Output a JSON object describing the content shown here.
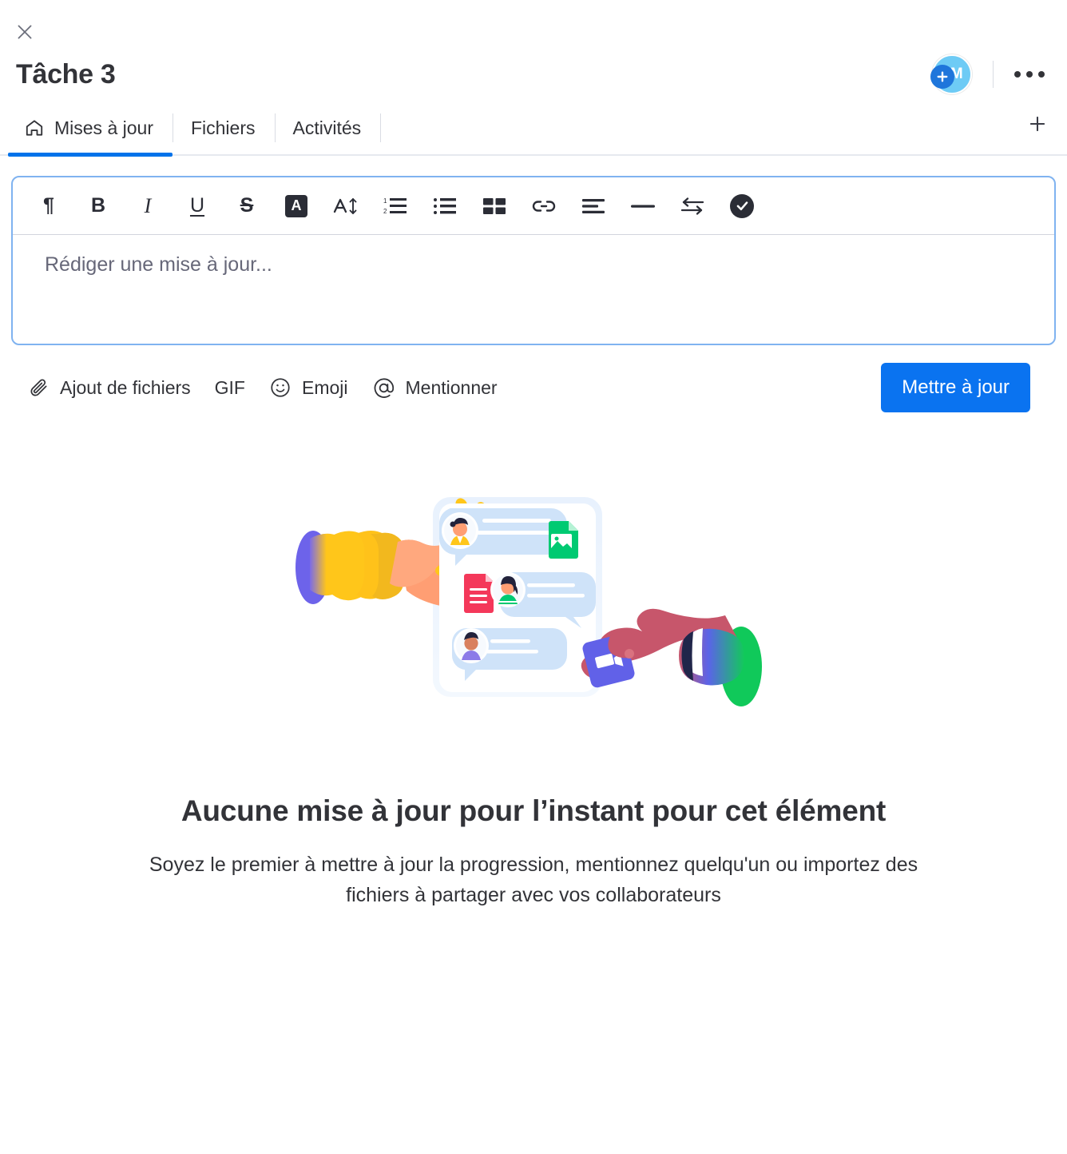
{
  "header": {
    "close_icon": "close-icon",
    "title": "Tâche 3",
    "avatar": {
      "initials": "TM",
      "add_icon": "plus-icon",
      "color": "#6ECBF5",
      "badge_color": "#1F76DB"
    },
    "more_icon": "more-horizontal-icon"
  },
  "tabs": {
    "items": [
      {
        "label": "Mises à jour",
        "icon": "home-icon",
        "active": true
      },
      {
        "label": "Fichiers",
        "icon": "",
        "active": false
      },
      {
        "label": "Activités",
        "icon": "",
        "active": false
      }
    ],
    "add_tab_icon": "plus-icon",
    "active_color": "#0073EA"
  },
  "editor": {
    "placeholder": "Rédiger une mise à jour...",
    "value": "",
    "border_color": "#80B3F0",
    "toolbar": [
      {
        "name": "paragraph-button",
        "glyph": "¶",
        "kind": "text"
      },
      {
        "name": "bold-button",
        "glyph": "B",
        "kind": "bold"
      },
      {
        "name": "italic-button",
        "glyph": "I",
        "kind": "italic"
      },
      {
        "name": "underline-button",
        "glyph": "U",
        "kind": "underline"
      },
      {
        "name": "strikethrough-button",
        "glyph": "S",
        "kind": "strike"
      },
      {
        "name": "text-color-button",
        "glyph": "A",
        "kind": "colorbox"
      },
      {
        "name": "font-size-button",
        "glyph": "A",
        "kind": "fontsize"
      },
      {
        "name": "numbered-list-button",
        "glyph": "",
        "kind": "numlist"
      },
      {
        "name": "bulleted-list-button",
        "glyph": "",
        "kind": "bullist"
      },
      {
        "name": "table-button",
        "glyph": "",
        "kind": "table"
      },
      {
        "name": "link-button",
        "glyph": "",
        "kind": "link"
      },
      {
        "name": "align-button",
        "glyph": "",
        "kind": "align"
      },
      {
        "name": "horizontal-rule-button",
        "glyph": "",
        "kind": "rule"
      },
      {
        "name": "indent-swap-button",
        "glyph": "",
        "kind": "swap"
      },
      {
        "name": "checklist-button",
        "glyph": "",
        "kind": "check"
      }
    ]
  },
  "actions": {
    "attach_label": "Ajout de fichiers",
    "attach_icon": "paperclip-icon",
    "gif_label": "GIF",
    "emoji_label": "Emoji",
    "emoji_icon": "smiley-icon",
    "mention_label": "Mentionner",
    "mention_icon": "at-sign-icon",
    "submit_label": "Mettre à jour",
    "submit_color": "#0A73F0"
  },
  "empty_state": {
    "illustration": "two-hands-sharing-chat-card-illustration",
    "title": "Aucune mise à jour pour l’instant pour cet élément",
    "subtitle": "Soyez le premier à mettre à jour la progression, mentionnez quelqu'un ou importez des fichiers à partager avec vos collaborateurs"
  }
}
